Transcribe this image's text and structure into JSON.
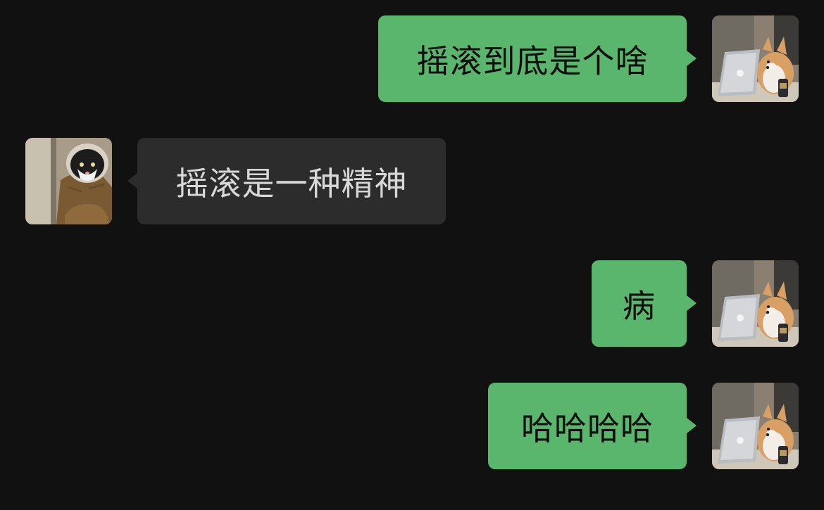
{
  "messages": [
    {
      "side": "sent",
      "avatar": "corgi-avatar",
      "text": "摇滚到底是个啥"
    },
    {
      "side": "received",
      "avatar": "cat-avatar",
      "text": "摇滚是一种精神"
    },
    {
      "side": "sent",
      "avatar": "corgi-avatar",
      "text": "病"
    },
    {
      "side": "sent",
      "avatar": "corgi-avatar",
      "text": "哈哈哈哈"
    }
  ],
  "colors": {
    "background": "#111111",
    "sent_bubble": "#5ab56d",
    "received_bubble": "#2c2c2c",
    "sent_text": "#0e0e0e",
    "received_text": "#d8d8d8"
  }
}
